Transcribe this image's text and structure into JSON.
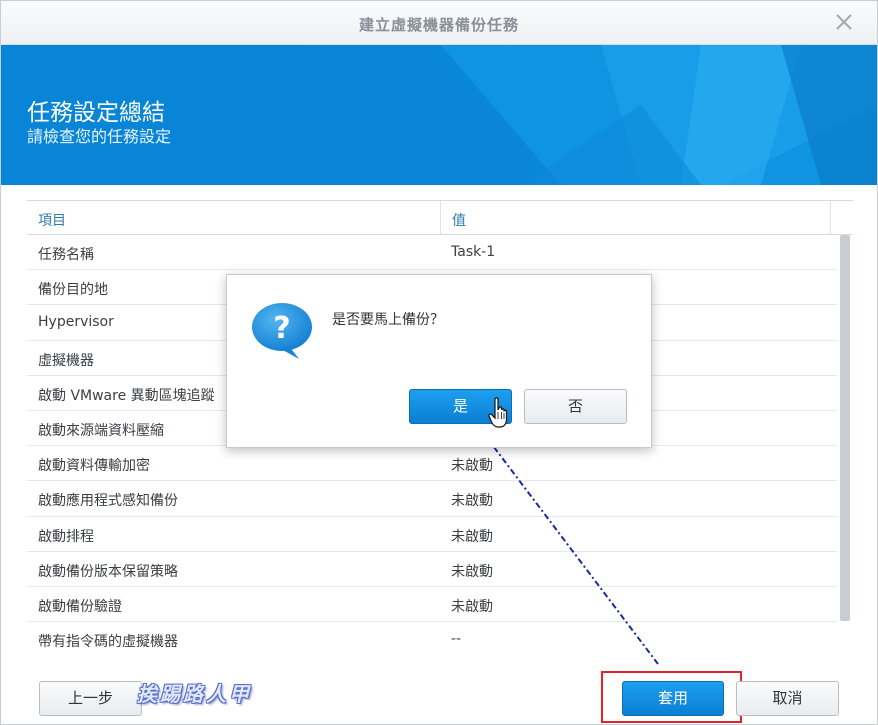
{
  "window": {
    "title": "建立虛擬機器備份任務"
  },
  "banner": {
    "heading": "任務設定總結",
    "subheading": "請檢查您的任務設定"
  },
  "table": {
    "headers": {
      "item": "項目",
      "value": "值"
    },
    "rows": [
      {
        "key": "任務名稱",
        "value": "Task-1"
      },
      {
        "key": "備份目的地",
        "value": ""
      },
      {
        "key": "Hypervisor",
        "value": ""
      },
      {
        "key": "虛擬機器",
        "value": ""
      },
      {
        "key": "啟動 VMware 異動區塊追蹤",
        "value": ""
      },
      {
        "key": "啟動來源端資料壓縮",
        "value": ""
      },
      {
        "key": "啟動資料傳輸加密",
        "value": "未啟動"
      },
      {
        "key": "啟動應用程式感知備份",
        "value": "未啟動"
      },
      {
        "key": "啟動排程",
        "value": "未啟動"
      },
      {
        "key": "啟動備份版本保留策略",
        "value": "未啟動"
      },
      {
        "key": "啟動備份驗證",
        "value": "未啟動"
      },
      {
        "key": "帶有指令碼的虛擬機器",
        "value": "--"
      }
    ]
  },
  "dialog": {
    "message": "是否要馬上備份？",
    "yes_label": "是",
    "no_label": "否"
  },
  "footer": {
    "prev_label": "上一步",
    "apply_label": "套用",
    "cancel_label": "取消",
    "watermark": "挨踢路人甲"
  },
  "colors": {
    "accent": "#0a87d9",
    "highlight": "#e0252a",
    "arrow": "#1a2a9c"
  },
  "icons": {
    "close": "close-icon",
    "question": "question-icon",
    "cursor": "hand-cursor-icon"
  }
}
